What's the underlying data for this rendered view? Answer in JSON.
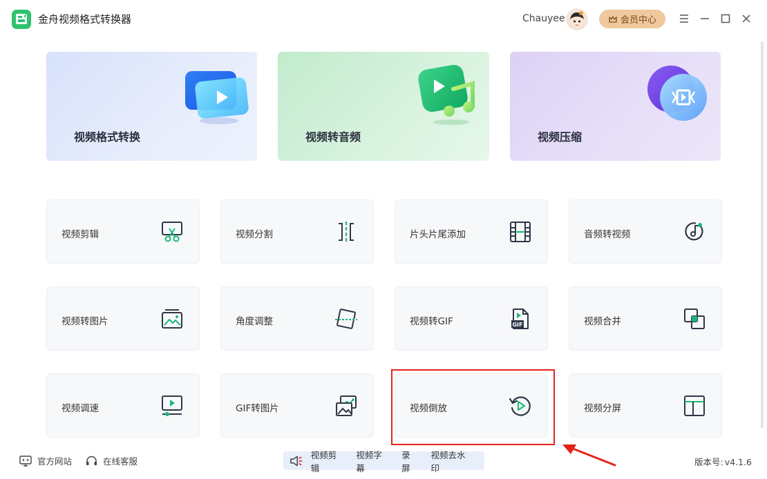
{
  "app": {
    "title": "金舟视频格式转换器",
    "username": "Chauyee",
    "vip_label": "会员中心"
  },
  "hero_cards": [
    {
      "label": "视频格式转换",
      "icon": "video-play-icon"
    },
    {
      "label": "视频转音频",
      "icon": "music-note-icon"
    },
    {
      "label": "视频压缩",
      "icon": "compress-icon"
    }
  ],
  "tools": [
    {
      "label": "视频剪辑",
      "icon": "scissors-icon"
    },
    {
      "label": "视频分割",
      "icon": "split-icon"
    },
    {
      "label": "片头片尾添加",
      "icon": "film-strip-icon"
    },
    {
      "label": "音频转视频",
      "icon": "audio-disc-icon"
    },
    {
      "label": "视频转图片",
      "icon": "image-icon"
    },
    {
      "label": "角度调整",
      "icon": "rotate-frame-icon"
    },
    {
      "label": "视频转GIF",
      "icon": "gif-file-icon",
      "badge": "GIF"
    },
    {
      "label": "视频合并",
      "icon": "merge-icon"
    },
    {
      "label": "视频调速",
      "icon": "speed-screen-icon"
    },
    {
      "label": "GIF转图片",
      "icon": "gif-to-image-icon"
    },
    {
      "label": "视频倒放",
      "icon": "reverse-play-icon"
    },
    {
      "label": "视频分屏",
      "icon": "split-screen-icon"
    }
  ],
  "footer": {
    "website": "官方网站",
    "support": "在线客服",
    "quick_links": [
      "视频剪辑",
      "视频字幕",
      "录屏",
      "视频去水印"
    ],
    "version_label": "版本号:",
    "version_value": "v4.1.6"
  },
  "colors": {
    "accent_green": "#19b87a",
    "icon_dark": "#2e3645",
    "highlight_red": "#e3231b",
    "vip_gold": "#efc89d"
  }
}
